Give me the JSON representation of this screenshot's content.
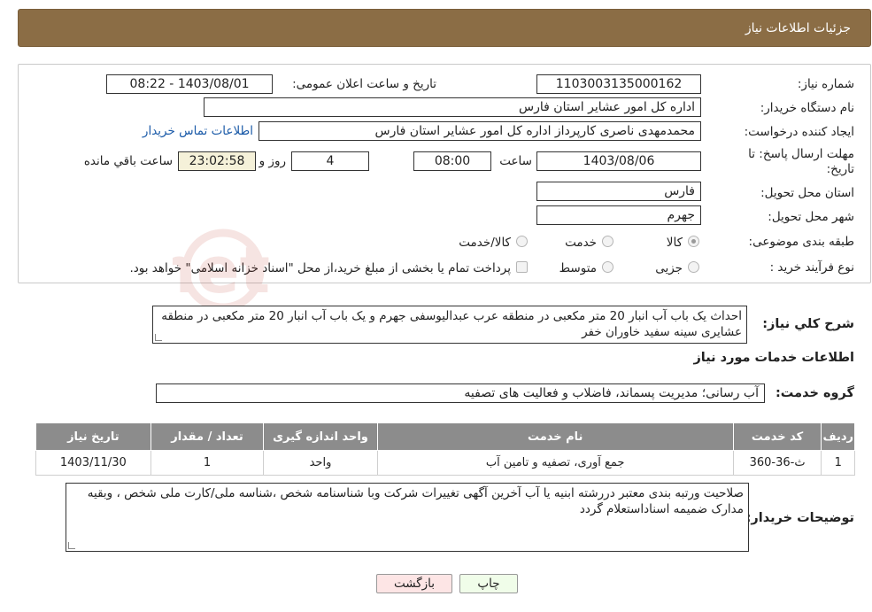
{
  "header": {
    "title": "جزئیات اطلاعات نیاز"
  },
  "form": {
    "need_number_label": "شماره نیاز:",
    "need_number": "1103003135000162",
    "announce_label": "تاریخ و ساعت اعلان عمومی:",
    "announce_value": "1403/08/01 - 08:22",
    "buyer_org_label": "نام دستگاه خریدار:",
    "buyer_org": "اداره کل امور عشایر استان فارس",
    "creator_label": "ایجاد کننده درخواست:",
    "creator": "محمدمهدی ناصری کارپرداز اداره کل امور عشایر استان فارس",
    "contact_link": "اطلاعات تماس خریدار",
    "deadline_label_1": "مهلت ارسال پاسخ: تا",
    "deadline_label_2": "تاریخ:",
    "deadline_date": "1403/08/06",
    "time_label": "ساعت",
    "deadline_time": "08:00",
    "days_value": "4",
    "days_label": "روز و",
    "remaining_time": "23:02:58",
    "remaining_label": "ساعت باقي مانده",
    "province_label": "استان محل تحویل:",
    "province": "فارس",
    "city_label": "شهر محل تحویل:",
    "city": "جهرم",
    "category_label": "طبقه بندی موضوعی:",
    "category_options": [
      {
        "label": "کالا",
        "checked": true
      },
      {
        "label": "خدمت",
        "checked": false
      },
      {
        "label": "کالا/خدمت",
        "checked": false
      }
    ],
    "process_label": "نوع فرآیند خرید :",
    "process_options": [
      {
        "label": "جزیی",
        "checked": false
      },
      {
        "label": "متوسط",
        "checked": false
      }
    ],
    "payment_note": "پرداخت تمام یا بخشی از مبلغ خرید،از محل \"اسناد خزانه اسلامی\" خواهد بود."
  },
  "description": {
    "label": "شرح كلي نياز:",
    "text": "احداث یک باب آب انبار 20 متر مکعبی در منطقه عرب عبدالیوسفی جهرم و یک باب آب انبار 20 متر مکعبی در منطقه عشایری سینه سفید خاوران خفر"
  },
  "services_section": {
    "title": "اطلاعات خدمات مورد نياز",
    "group_label": "گروه خدمت:",
    "group_value": "آب رسانی؛ مدیریت پسماند، فاضلاب و فعالیت های تصفیه"
  },
  "table": {
    "columns": [
      "ردیف",
      "کد خدمت",
      "نام خدمت",
      "واحد اندازه گیری",
      "تعداد / مقدار",
      "تاریخ نیاز"
    ],
    "rows": [
      [
        "1",
        "ث-36-360",
        "جمع آوری، تصفیه و تامین آب",
        "واحد",
        "1",
        "1403/11/30"
      ]
    ]
  },
  "buyer_notes": {
    "label": "توضیحات خریدار:",
    "text": "صلاحیت ورتبه بندی معتبر دررشته  ابنیه یا آب  آخرین آگهی تغییرات شرکت وبا شناسنامه شخص ،شناسه ملی/کارت ملی شخص ، وبقیه مدارک  ضمیمه اسناداستعلام گردد"
  },
  "buttons": {
    "print": "چاپ",
    "back": "بازگشت"
  },
  "colors": {
    "header_bg": "#8b6d45",
    "table_header_bg": "#8c8c8c",
    "print_bg": "#f0fde9",
    "back_bg": "#fde5e5"
  },
  "watermark": {
    "text": "AriaTender.net"
  }
}
